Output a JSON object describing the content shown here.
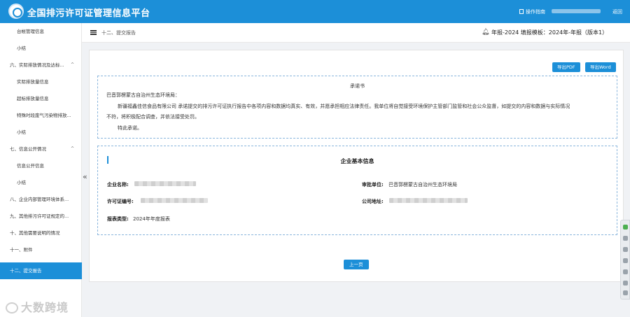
{
  "topbar": {
    "title": "全国排污许可证管理信息平台",
    "guide": "操作指南",
    "back": "返回",
    "color": "#1c8fd8"
  },
  "sidebar": {
    "items": [
      {
        "label": "台帐管理信息",
        "level": "sub"
      },
      {
        "label": "小结",
        "level": "sub"
      },
      {
        "label": "六、实际排放情况及达标...",
        "level": "group",
        "chevron": "^"
      },
      {
        "label": "实际排放量信息",
        "level": "sub"
      },
      {
        "label": "超标排放量信息",
        "level": "sub"
      },
      {
        "label": "特殊时段废气污染物排放...",
        "level": "sub"
      },
      {
        "label": "小结",
        "level": "sub"
      },
      {
        "label": "七、信息公开情况",
        "level": "group",
        "chevron": "^"
      },
      {
        "label": "信息公开信息",
        "level": "sub"
      },
      {
        "label": "小结",
        "level": "sub"
      },
      {
        "label": "八、企业内部管理环境体系...",
        "level": "group"
      },
      {
        "label": "九、其他排污许可证规定的...",
        "level": "group"
      },
      {
        "label": "十、其他需要说明的情况",
        "level": "group"
      },
      {
        "label": "十一、附件",
        "level": "group"
      },
      {
        "label": "十二、提交报告",
        "level": "group",
        "active": true
      }
    ],
    "collapse_icon": "«"
  },
  "header": {
    "breadcrumb": "十二、提交报告",
    "report_info": "年报-2024  填报模板：2024年-年报（版本1）"
  },
  "actions": {
    "export_pdf": "导出PDF",
    "export_word": "导出Word"
  },
  "promise": {
    "title": "承诺书",
    "addressee": "巴音郭楞蒙古自治州生态环境局：",
    "line1": "新疆福鑫佳信食品有限公司 承诺提交的排污许可证执行报告中各项内容和数据均真实、有效，并愿承担相应法律责任。我单位将自觉接受环境保护主管部门监管和社会公众监督，如提交的内容和数据与实际情况",
    "line2": "不符，将积极配合调查，并依法接受处罚。",
    "closing": "特此承诺。"
  },
  "company": {
    "section_title": "企业基本信息",
    "name_label": "企业名称:",
    "authority_label": "审批单位:",
    "authority_value": "巴音郭楞蒙古自治州生态环境局",
    "license_label": "许可证编号:",
    "address_label": "公司地址:",
    "report_type_label": "报表类型:",
    "report_type_value": "2024年年度报表"
  },
  "footer": {
    "prev_button": "上一页"
  },
  "watermark": "大数跨境"
}
